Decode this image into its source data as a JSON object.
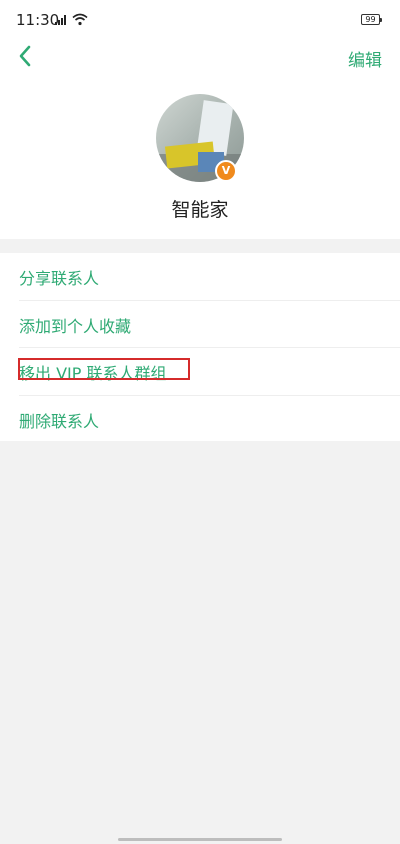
{
  "status_bar": {
    "time": "11:30",
    "battery": "99"
  },
  "nav": {
    "edit_label": "编辑"
  },
  "contact": {
    "name": "智能家",
    "badge": "V"
  },
  "menu": {
    "items": [
      {
        "label": "分享联系人"
      },
      {
        "label": "添加到个人收藏"
      },
      {
        "label": "移出 VIP 联系人群组"
      },
      {
        "label": "删除联系人"
      }
    ]
  },
  "colors": {
    "accent": "#2faa74",
    "badge": "#f08a1c",
    "highlight": "#d52b2b",
    "background": "#f2f2f2"
  }
}
